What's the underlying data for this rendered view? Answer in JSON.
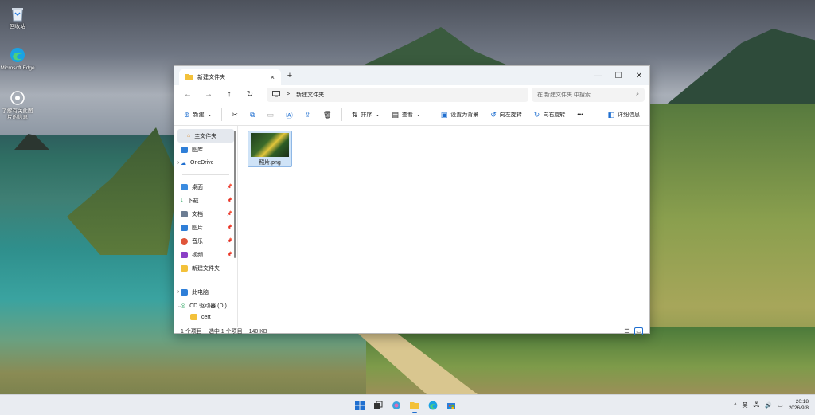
{
  "desktop": {
    "icons": [
      {
        "label": "回收站"
      },
      {
        "label": "Microsoft Edge"
      },
      {
        "label": "了解有关此图片的信息"
      }
    ]
  },
  "explorer": {
    "tab_title": "新建文件夹",
    "close_tab": "×",
    "new_tab": "+",
    "window_controls": {
      "minimize": "—",
      "maximize": "☐",
      "close": "✕"
    },
    "nav": {
      "back": "←",
      "forward": "→",
      "up": "↑",
      "refresh": "↻"
    },
    "path": {
      "separator": ">",
      "folder": "新建文件夹"
    },
    "search_placeholder": "在 新建文件夹 中搜索",
    "search_glyph": "⌕",
    "toolbar": {
      "new": "新建",
      "sort": "排序",
      "view": "查看",
      "set_background": "设置为背景",
      "rotate_left": "向左旋转",
      "rotate_right": "向右旋转",
      "more": "•••",
      "details": "详细信息"
    },
    "sidebar": {
      "home": "主文件夹",
      "gallery": "图库",
      "onedrive": "OneDrive",
      "pinned": [
        {
          "label": "桌面"
        },
        {
          "label": "下载"
        },
        {
          "label": "文档"
        },
        {
          "label": "图片"
        },
        {
          "label": "音乐"
        },
        {
          "label": "视频"
        },
        {
          "label": "新建文件夹"
        }
      ],
      "this_pc": "此电脑",
      "cd_drive": "CD 驱动器 (D:)",
      "cd_sub": "cert"
    },
    "files": [
      {
        "name": "照片.png"
      }
    ],
    "status": {
      "count": "1 个项目",
      "selected": "选中 1 个项目",
      "size": "140 KB"
    }
  },
  "taskbar": {
    "tray": {
      "chevron": "^",
      "ime": "英",
      "date_time_top": "20:18",
      "date_time_bottom": "2026/9/8"
    }
  },
  "colors": {
    "accent": "#1f6fd0",
    "folder": "#f3c13a",
    "selection": "#cfe3f7"
  }
}
